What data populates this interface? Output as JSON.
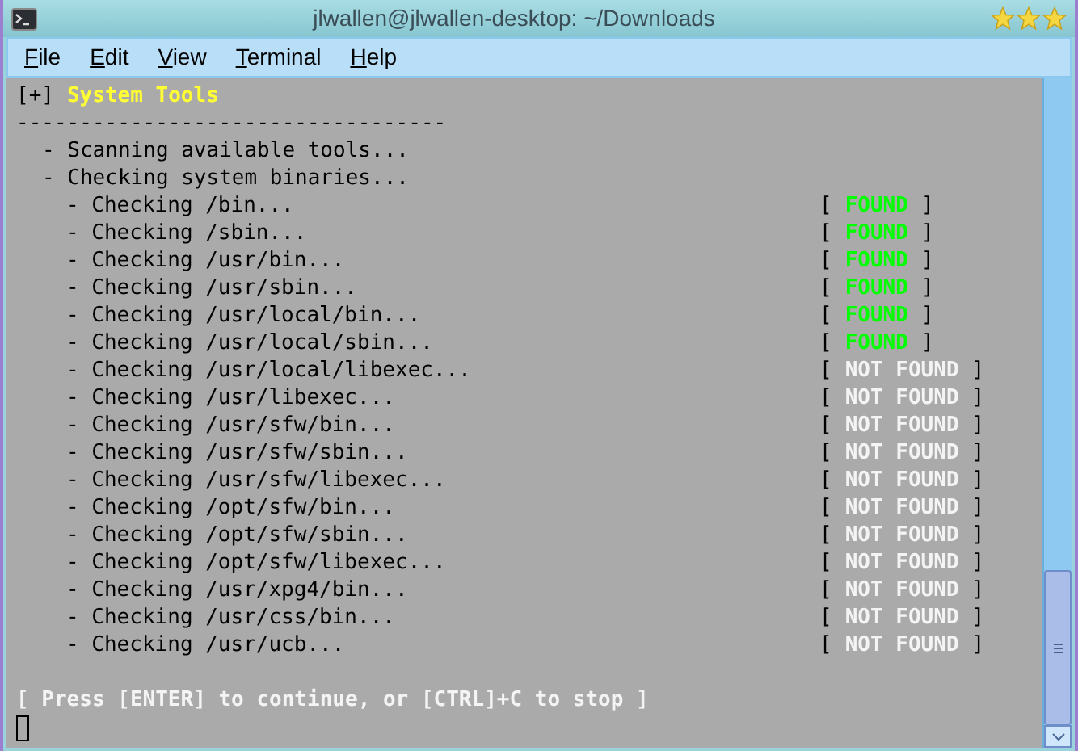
{
  "window": {
    "title": "jlwallen@jlwallen-desktop: ~/Downloads"
  },
  "menu": [
    "File",
    "Edit",
    "View",
    "Terminal",
    "Help"
  ],
  "terminal": {
    "header": {
      "prefix": "[+]",
      "title": "System Tools"
    },
    "rule": "----------------------------------",
    "lines": [
      {
        "text": "- Scanning available tools..."
      },
      {
        "text": "- Checking system binaries...",
        "children": [
          {
            "text": "- Checking /bin...",
            "open": "[",
            "status": "FOUND",
            "close": "]",
            "kind": "found"
          },
          {
            "text": "- Checking /sbin...",
            "open": "[",
            "status": "FOUND",
            "close": "]",
            "kind": "found"
          },
          {
            "text": "- Checking /usr/bin...",
            "open": "[",
            "status": "FOUND",
            "close": "]",
            "kind": "found"
          },
          {
            "text": "- Checking /usr/sbin...",
            "open": "[",
            "status": "FOUND",
            "close": "]",
            "kind": "found"
          },
          {
            "text": "- Checking /usr/local/bin...",
            "open": "[",
            "status": "FOUND",
            "close": "]",
            "kind": "found"
          },
          {
            "text": "- Checking /usr/local/sbin...",
            "open": "[",
            "status": "FOUND",
            "close": "]",
            "kind": "found"
          },
          {
            "text": "- Checking /usr/local/libexec...",
            "open": "[",
            "status": "NOT FOUND",
            "close": "]",
            "kind": "missing"
          },
          {
            "text": "- Checking /usr/libexec...",
            "open": "[",
            "status": "NOT FOUND",
            "close": "]",
            "kind": "missing"
          },
          {
            "text": "- Checking /usr/sfw/bin...",
            "open": "[",
            "status": "NOT FOUND",
            "close": "]",
            "kind": "missing"
          },
          {
            "text": "- Checking /usr/sfw/sbin...",
            "open": "[",
            "status": "NOT FOUND",
            "close": "]",
            "kind": "missing"
          },
          {
            "text": "- Checking /usr/sfw/libexec...",
            "open": "[",
            "status": "NOT FOUND",
            "close": "]",
            "kind": "missing"
          },
          {
            "text": "- Checking /opt/sfw/bin...",
            "open": "[",
            "status": "NOT FOUND",
            "close": "]",
            "kind": "missing"
          },
          {
            "text": "- Checking /opt/sfw/sbin...",
            "open": "[",
            "status": "NOT FOUND",
            "close": "]",
            "kind": "missing"
          },
          {
            "text": "- Checking /opt/sfw/libexec...",
            "open": "[",
            "status": "NOT FOUND",
            "close": "]",
            "kind": "missing"
          },
          {
            "text": "- Checking /usr/xpg4/bin...",
            "open": "[",
            "status": "NOT FOUND",
            "close": "]",
            "kind": "missing"
          },
          {
            "text": "- Checking /usr/css/bin...",
            "open": "[",
            "status": "NOT FOUND",
            "close": "]",
            "kind": "missing"
          },
          {
            "text": "- Checking /usr/ucb...",
            "open": "[",
            "status": "NOT FOUND",
            "close": "]",
            "kind": "missing"
          }
        ]
      }
    ],
    "prompt": "[ Press [ENTER] to continue, or [CTRL]+C to stop ]"
  }
}
